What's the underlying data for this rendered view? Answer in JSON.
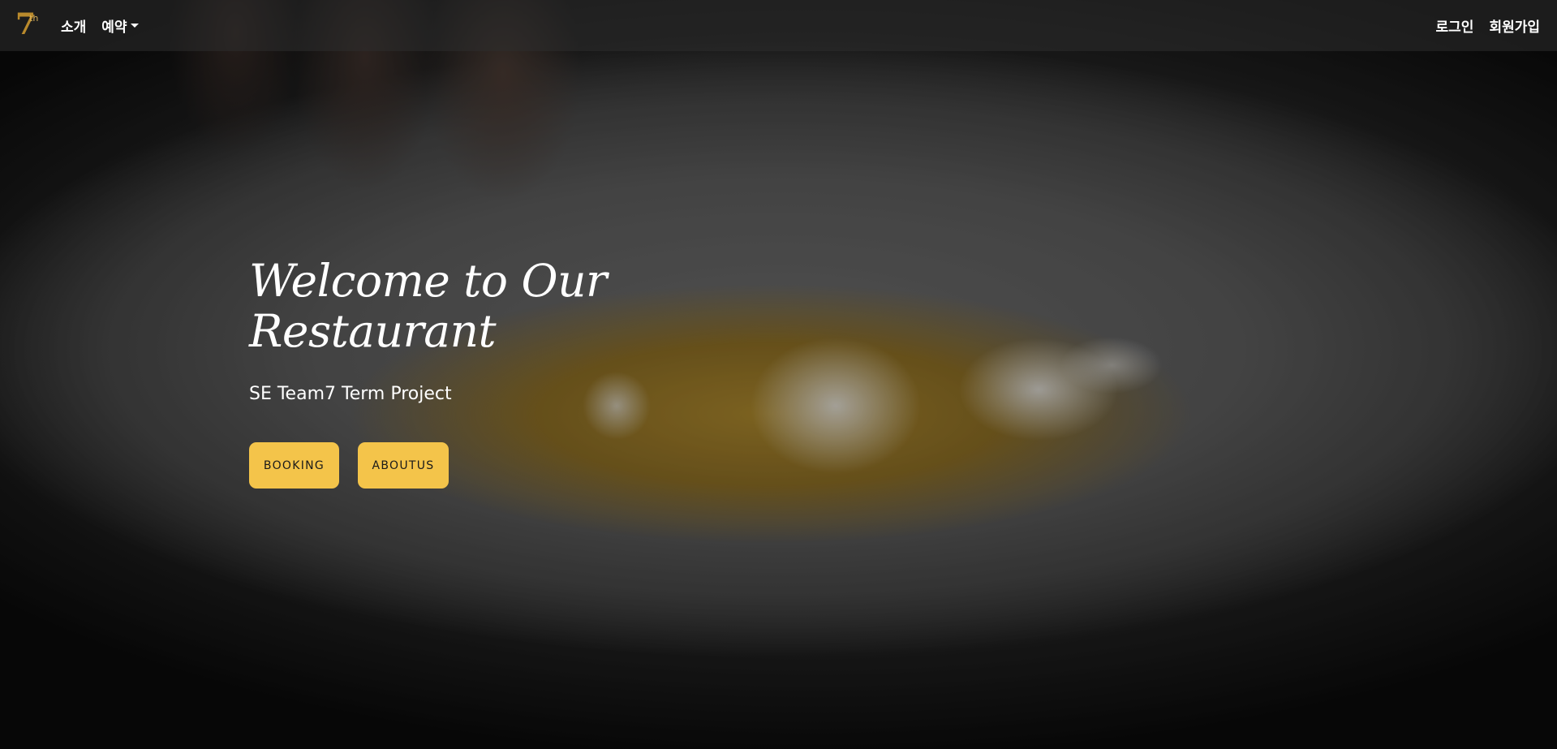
{
  "navbar": {
    "brand": {
      "logo_text": "7",
      "logo_sup": "th",
      "logo_color": "#b98a2c"
    },
    "left_links": [
      {
        "label": "소개"
      },
      {
        "label": "예약",
        "has_dropdown": true
      }
    ],
    "right_links": [
      {
        "label": "로그인"
      },
      {
        "label": "회원가입"
      }
    ]
  },
  "hero": {
    "title": "Welcome to Our Restaurant",
    "subtitle": "SE Team7 Term Project",
    "buttons": [
      {
        "label": "BOOKING"
      },
      {
        "label": "ABOUTUS"
      }
    ],
    "accent_color": "#f4c44a"
  }
}
